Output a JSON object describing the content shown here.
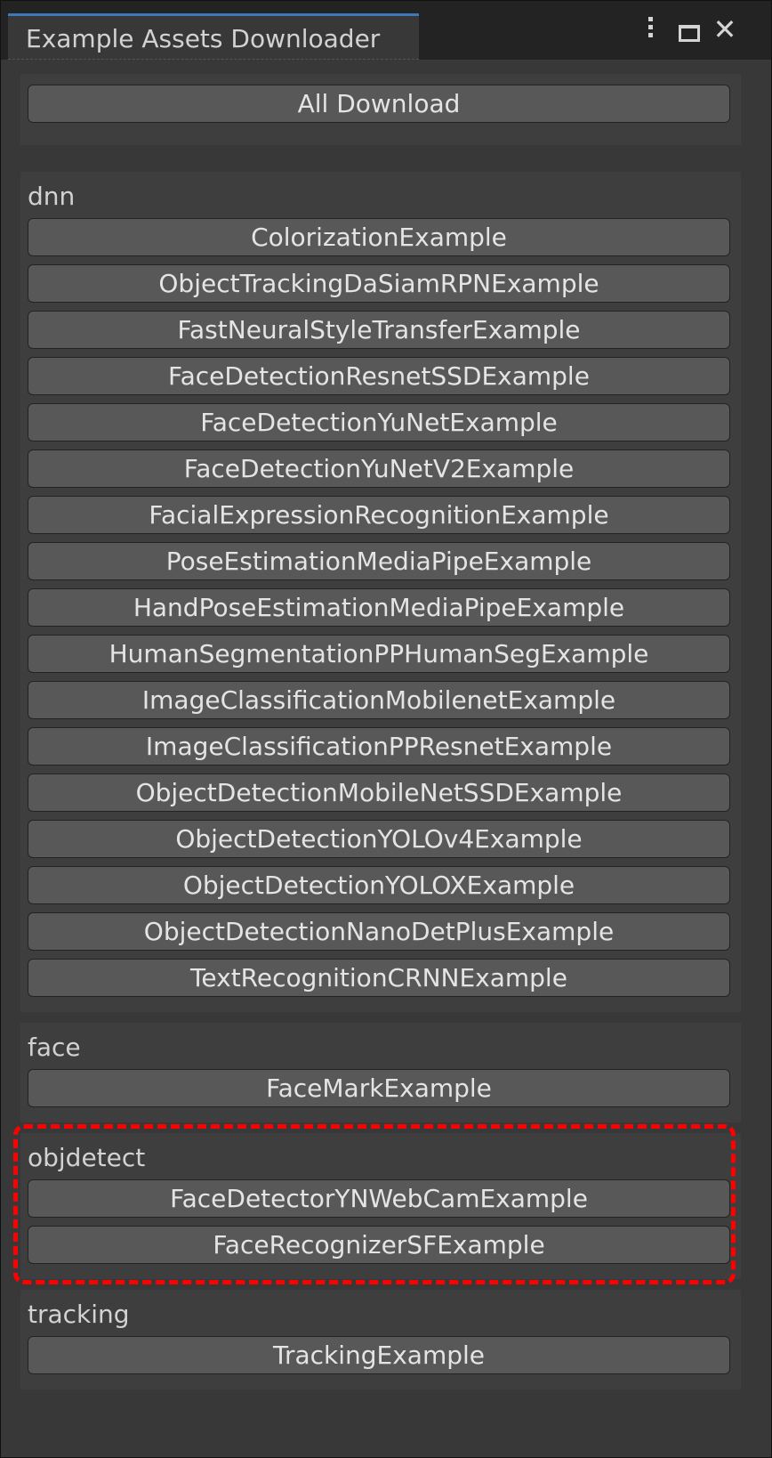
{
  "window": {
    "title": "Example Assets Downloader",
    "controls": [
      "more-options-icon",
      "maximize-icon",
      "close-icon"
    ]
  },
  "all_download_label": "All Download",
  "sections": [
    {
      "label": "dnn",
      "buttons": [
        "ColorizationExample",
        "ObjectTrackingDaSiamRPNExample",
        "FastNeuralStyleTransferExample",
        "FaceDetectionResnetSSDExample",
        "FaceDetectionYuNetExample",
        "FaceDetectionYuNetV2Example",
        "FacialExpressionRecognitionExample",
        "PoseEstimationMediaPipeExample",
        "HandPoseEstimationMediaPipeExample",
        "HumanSegmentationPPHumanSegExample",
        "ImageClassificationMobilenetExample",
        "ImageClassificationPPResnetExample",
        "ObjectDetectionMobileNetSSDExample",
        "ObjectDetectionYOLOv4Example",
        "ObjectDetectionYOLOXExample",
        "ObjectDetectionNanoDetPlusExample",
        "TextRecognitionCRNNExample"
      ]
    },
    {
      "label": "face",
      "buttons": [
        "FaceMarkExample"
      ]
    },
    {
      "label": "objdetect",
      "buttons": [
        "FaceDetectorYNWebCamExample",
        "FaceRecognizerSFExample"
      ]
    },
    {
      "label": "tracking",
      "buttons": [
        "TrackingExample"
      ]
    }
  ],
  "colors": {
    "panel": "#383838",
    "section": "#3e3e3e",
    "button": "#585858",
    "text": "#e4e4e4",
    "tab_accent": "#3a79bb",
    "highlight": "#ff0000"
  }
}
